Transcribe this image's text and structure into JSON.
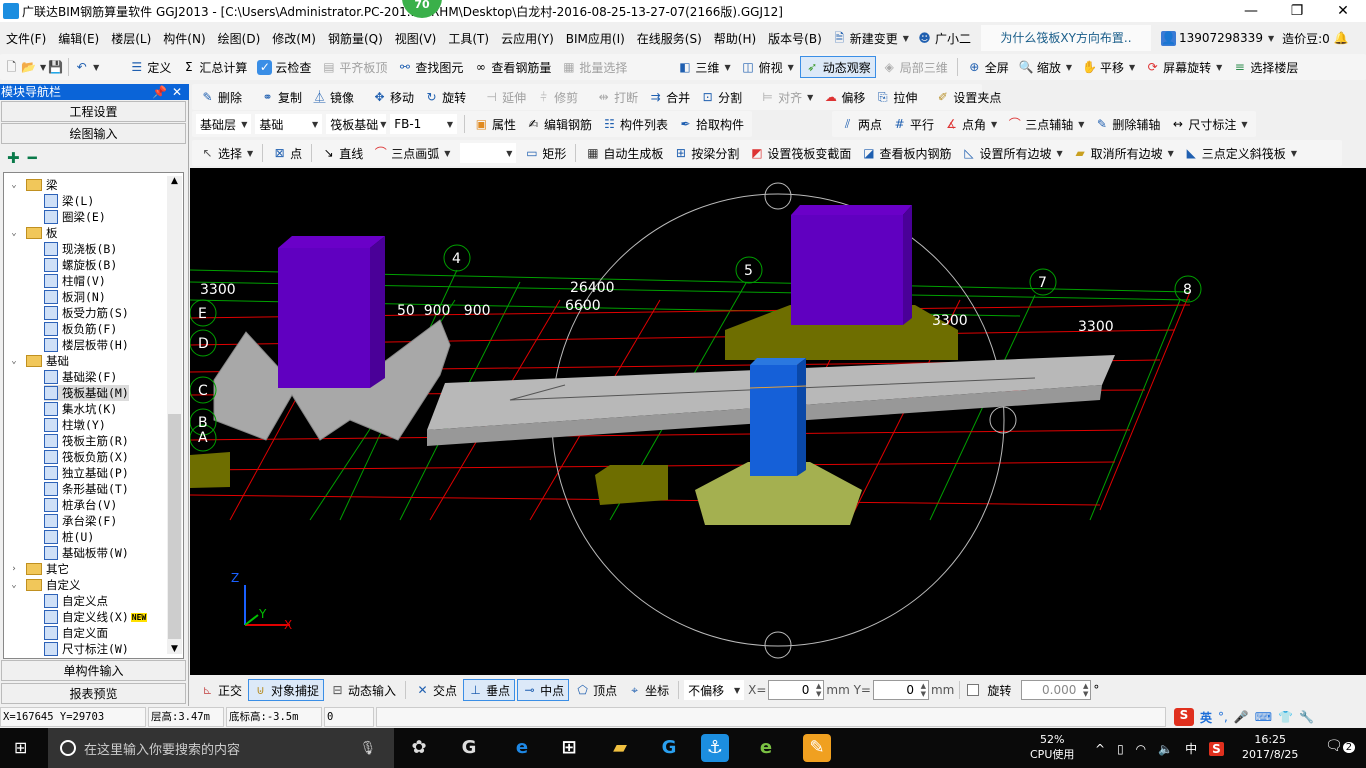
{
  "window": {
    "title": "广联达BIM钢筋算量软件 GGJ2013 - [C:\\Users\\Administrator.PC-201... NRHM\\Desktop\\白龙村-2016-08-25-13-27-07(2166版).GGJ12]",
    "badge": "70",
    "minimize": "—",
    "maximize": "❐",
    "close": "✕"
  },
  "menu": {
    "items": [
      "文件(F)",
      "编辑(E)",
      "楼层(L)",
      "构件(N)",
      "绘图(D)",
      "修改(M)",
      "钢筋量(Q)",
      "视图(V)",
      "工具(T)",
      "云应用(Y)",
      "BIM应用(I)",
      "在线服务(S)",
      "帮助(H)",
      "版本号(B)"
    ],
    "new_change": "新建变更",
    "assistant": "广小二",
    "tip": "为什么筏板XY方向布置..",
    "user": "13907298339",
    "beans": "造价豆:0"
  },
  "toolbar1": {
    "define": "定义",
    "sum": "汇总计算",
    "cloud_check": "云检查",
    "align_top": "平齐板顶",
    "find": "查找图元",
    "view_rebar": "查看钢筋量",
    "batch_select": "批量选择",
    "three_d": "三维",
    "top_view": "俯视",
    "dynamic": "动态观察",
    "local_3d": "局部三维",
    "fullscreen": "全屏",
    "zoom": "缩放",
    "pan": "平移",
    "rotate_screen": "屏幕旋转",
    "select_floor": "选择楼层"
  },
  "toolbar2": {
    "delete": "删除",
    "copy": "复制",
    "mirror": "镜像",
    "move": "移动",
    "rotate": "旋转",
    "extend": "延伸",
    "trim": "修剪",
    "break": "打断",
    "merge": "合并",
    "split": "分割",
    "align": "对齐",
    "offset": "偏移",
    "stretch": "拉伸",
    "grip": "设置夹点"
  },
  "toolbar3": {
    "floor": "基础层",
    "category": "基础",
    "type": "筏板基础",
    "component": "FB-1",
    "props": "属性",
    "edit_rebar": "编辑钢筋",
    "list": "构件列表",
    "pick": "拾取构件",
    "two_point": "两点",
    "parallel": "平行",
    "point_angle": "点角",
    "three_axis": "三点辅轴",
    "del_axis": "删除辅轴",
    "dimension": "尺寸标注"
  },
  "toolbar4": {
    "select": "选择",
    "point": "点",
    "line": "直线",
    "arc": "三点画弧",
    "arc_opt": "",
    "rect": "矩形",
    "auto": "自动生成板",
    "by_beam": "按梁分割",
    "variable": "设置筏板变截面",
    "view_inner": "查看板内钢筋",
    "set_slope": "设置所有边坡",
    "cancel_slope": "取消所有边坡",
    "three_point_slope": "三点定义斜筏板"
  },
  "nav": {
    "title": "模块导航栏",
    "project_settings": "工程设置",
    "drawing_input": "绘图输入",
    "single_input": "单构件输入",
    "report": "报表预览",
    "tree": [
      {
        "label": "梁",
        "level": 0,
        "folder": true,
        "open": true
      },
      {
        "label": "梁(L)",
        "level": 1
      },
      {
        "label": "圈梁(E)",
        "level": 1
      },
      {
        "label": "板",
        "level": 0,
        "folder": true,
        "open": true
      },
      {
        "label": "现浇板(B)",
        "level": 1
      },
      {
        "label": "螺旋板(B)",
        "level": 1
      },
      {
        "label": "柱帽(V)",
        "level": 1
      },
      {
        "label": "板洞(N)",
        "level": 1
      },
      {
        "label": "板受力筋(S)",
        "level": 1
      },
      {
        "label": "板负筋(F)",
        "level": 1
      },
      {
        "label": "楼层板带(H)",
        "level": 1
      },
      {
        "label": "基础",
        "level": 0,
        "folder": true,
        "open": true
      },
      {
        "label": "基础梁(F)",
        "level": 1
      },
      {
        "label": "筏板基础(M)",
        "level": 1,
        "selected": true
      },
      {
        "label": "集水坑(K)",
        "level": 1
      },
      {
        "label": "柱墩(Y)",
        "level": 1
      },
      {
        "label": "筏板主筋(R)",
        "level": 1
      },
      {
        "label": "筏板负筋(X)",
        "level": 1
      },
      {
        "label": "独立基础(P)",
        "level": 1
      },
      {
        "label": "条形基础(T)",
        "level": 1
      },
      {
        "label": "桩承台(V)",
        "level": 1
      },
      {
        "label": "承台梁(F)",
        "level": 1
      },
      {
        "label": "桩(U)",
        "level": 1
      },
      {
        "label": "基础板带(W)",
        "level": 1
      },
      {
        "label": "其它",
        "level": 0,
        "folder": true,
        "open": false
      },
      {
        "label": "自定义",
        "level": 0,
        "folder": true,
        "open": true
      },
      {
        "label": "自定义点",
        "level": 1
      },
      {
        "label": "自定义线(X)",
        "level": 1,
        "badge": "NEW"
      },
      {
        "label": "自定义面",
        "level": 1
      },
      {
        "label": "尺寸标注(W)",
        "level": 1
      }
    ]
  },
  "viewport": {
    "labels": {
      "dim_left": "3300",
      "axis4": "4",
      "axis5": "5",
      "axis7": "7",
      "axis8": "8",
      "axisE": "E",
      "axisD": "D",
      "axisC": "C",
      "axisB": "B",
      "axisA": "A",
      "dim_total": "26400",
      "dim_6600": "6600",
      "dim_small": "50  900   900",
      "dim_r1": "3300",
      "dim_r2": "3300"
    },
    "axes": {
      "z": "Z",
      "y": "Y",
      "x": "X"
    }
  },
  "snapbar": {
    "ortho": "正交",
    "snap": "对象捕捉",
    "dyn_input": "动态输入",
    "intersection": "交点",
    "perpendicular": "垂点",
    "midpoint": "中点",
    "vertex": "顶点",
    "coord": "坐标",
    "offset_mode": "不偏移",
    "x_label": "X=",
    "x_value": "0",
    "y_label": "mm Y=",
    "y_value": "0",
    "unit": "mm",
    "rotate": "旋转",
    "rotate_value": "0.000",
    "deg": "°"
  },
  "status": {
    "coords": "X=167645 Y=29703",
    "floor_height": "层高:3.47m",
    "base_elev": "底标高:-3.5m",
    "value": "0"
  },
  "taskbar": {
    "search_placeholder": "在这里输入你要搜索的内容",
    "cpu": "52%",
    "cpu_label": "CPU使用",
    "ime": "中",
    "time": "16:25",
    "date": "2017/8/25",
    "notifications": "2",
    "ime_bar": "英"
  }
}
